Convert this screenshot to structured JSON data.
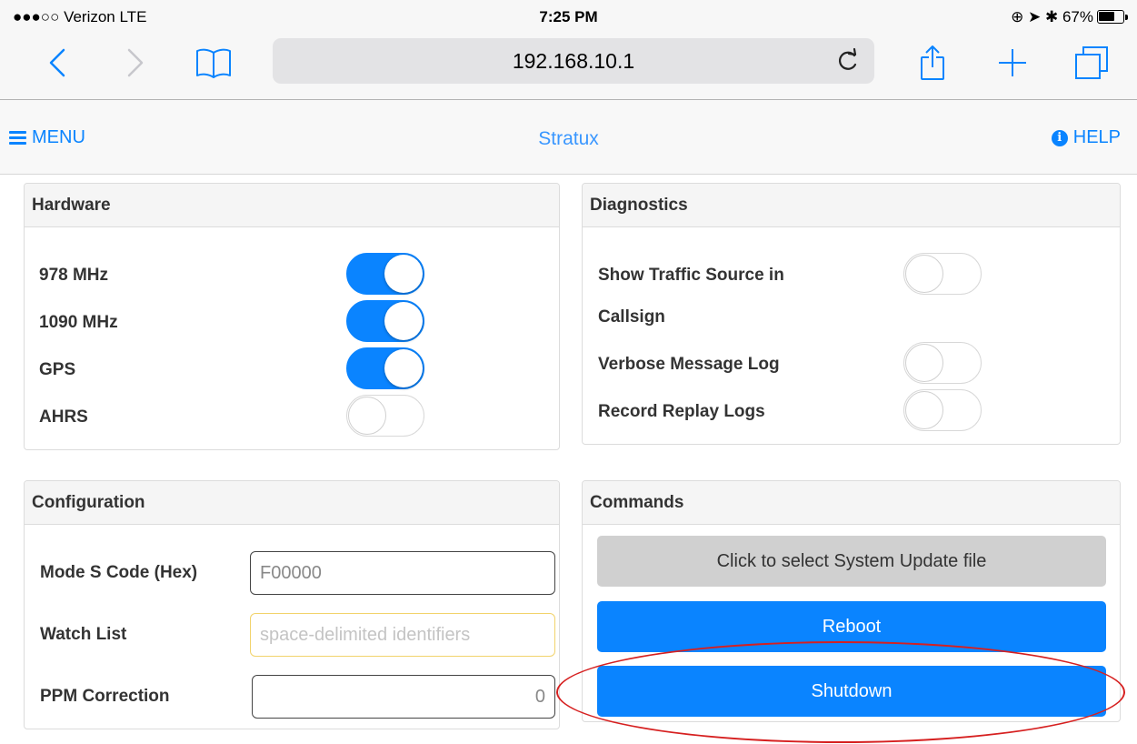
{
  "status_bar": {
    "carrier": "●●●○○ Verizon  LTE",
    "time": "7:25 PM",
    "indicators": "⊕ ➤ ✱ 67%",
    "battery_percent": 67
  },
  "browser": {
    "url": "192.168.10.1"
  },
  "nav": {
    "menu_label": "MENU",
    "title": "Stratux",
    "help_label": "HELP",
    "accent_color": "#0a84ff"
  },
  "hardware": {
    "title": "Hardware",
    "items": [
      {
        "label": "978 MHz",
        "on": true
      },
      {
        "label": "1090 MHz",
        "on": true
      },
      {
        "label": "GPS",
        "on": true
      },
      {
        "label": "AHRS",
        "on": false
      }
    ]
  },
  "diagnostics": {
    "title": "Diagnostics",
    "items": [
      {
        "label": "Show Traffic Source in",
        "label2": "Callsign",
        "on": false
      },
      {
        "label": "Verbose Message Log",
        "on": false
      },
      {
        "label": "Record Replay Logs",
        "on": false
      }
    ]
  },
  "configuration": {
    "title": "Configuration",
    "mode_s_label": "Mode S Code (Hex)",
    "mode_s_value": "F00000",
    "watch_list_label": "Watch List",
    "watch_list_placeholder": "space-delimited identifiers",
    "ppm_label": "PPM Correction",
    "ppm_value": "0"
  },
  "commands": {
    "title": "Commands",
    "update_label": "Click to select System Update file",
    "reboot_label": "Reboot",
    "shutdown_label": "Shutdown"
  },
  "annotation": {
    "color": "#d62020"
  }
}
